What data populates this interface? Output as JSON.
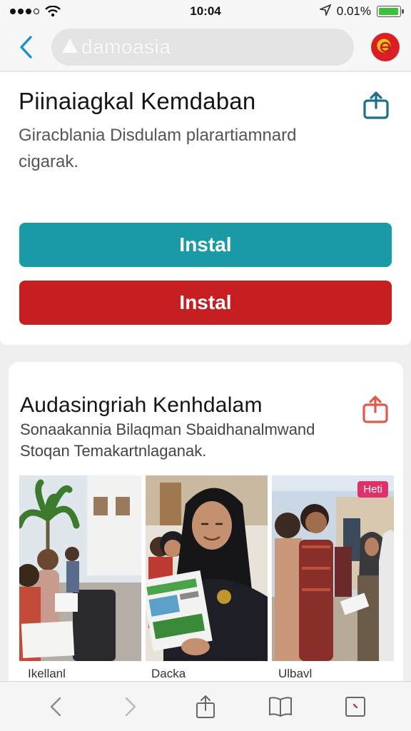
{
  "status_bar": {
    "time": "10:04",
    "battery": "0.01%",
    "battery_level": 0.95
  },
  "nav": {
    "url": "damoasia"
  },
  "hero": {
    "title": "Piinaiagkal Kemdaban",
    "description_line1": "Giracblania Disdulam plarartiamnard",
    "description_line2": "cigarak.",
    "install_primary": "Instal",
    "install_secondary": "Instal"
  },
  "section": {
    "title": "Audasingriah Kenhdalam",
    "description_line1": "Sonaakannia Bilaqman Sbaidhanalmwand",
    "description_line2": "Stoqan Temakartnlaganak.",
    "badge": "Heti"
  },
  "gallery": {
    "captions": [
      "Ikellanl",
      "Dacka",
      "Ulbavl"
    ]
  },
  "colors": {
    "teal": "#1a9aa5",
    "red": "#c71e22",
    "accent": "#1b6e8c"
  }
}
